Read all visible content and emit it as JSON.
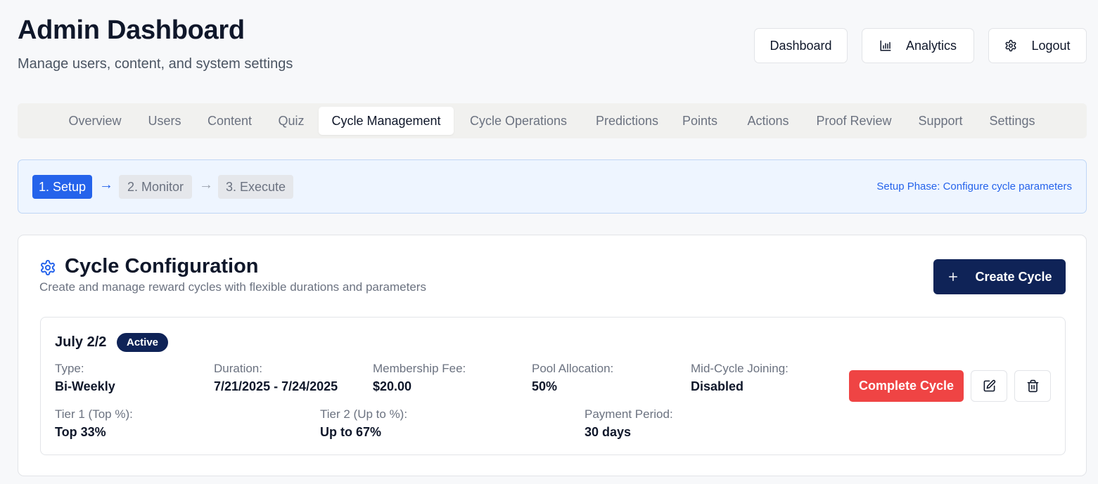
{
  "header": {
    "title": "Admin Dashboard",
    "subtitle": "Manage users, content, and system settings",
    "buttons": {
      "dashboard": "Dashboard",
      "analytics": "Analytics",
      "logout": "Logout"
    }
  },
  "tabs": [
    {
      "label": "Overview",
      "active": false
    },
    {
      "label": "Users",
      "active": false
    },
    {
      "label": "Content",
      "active": false
    },
    {
      "label": "Quiz",
      "active": false
    },
    {
      "label": "Cycle Management",
      "active": true
    },
    {
      "label": "Cycle Operations",
      "active": false
    },
    {
      "label": "Predictions",
      "active": false
    },
    {
      "label": "Points",
      "active": false
    },
    {
      "label": "Actions",
      "active": false
    },
    {
      "label": "Proof Review",
      "active": false
    },
    {
      "label": "Support",
      "active": false
    },
    {
      "label": "Settings",
      "active": false
    }
  ],
  "phase": {
    "steps": [
      {
        "label": "1. Setup",
        "active": true
      },
      {
        "label": "2. Monitor",
        "active": false
      },
      {
        "label": "3. Execute",
        "active": false
      }
    ],
    "arrow": "→",
    "note": "Setup Phase: Configure cycle parameters"
  },
  "config": {
    "title": "Cycle Configuration",
    "description": "Create and manage reward cycles with flexible durations and parameters",
    "create_label": "Create Cycle",
    "cycle": {
      "name": "July 2/2",
      "status": "Active",
      "fields_row1": [
        {
          "label": "Type:",
          "value": "Bi-Weekly"
        },
        {
          "label": "Duration:",
          "value": "7/21/2025 - 7/24/2025"
        },
        {
          "label": "Membership Fee:",
          "value": "$20.00"
        },
        {
          "label": "Pool Allocation:",
          "value": "50%"
        },
        {
          "label": "Mid-Cycle Joining:",
          "value": "Disabled"
        }
      ],
      "fields_row2": [
        {
          "label": "Tier 1 (Top %):",
          "value": "Top 33%"
        },
        {
          "label": "Tier 2 (Up to %):",
          "value": "Up to 67%"
        },
        {
          "label": "Payment Period:",
          "value": "30 days"
        }
      ],
      "complete_label": "Complete Cycle"
    }
  },
  "colors": {
    "primary_navy": "#0f2357",
    "accent_blue": "#2563eb",
    "danger_red": "#ef4444"
  }
}
